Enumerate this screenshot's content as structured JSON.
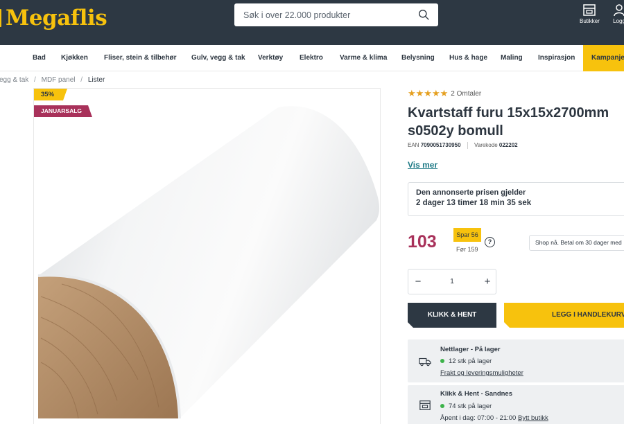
{
  "header": {
    "logo": "Megaflis",
    "search_placeholder": "Søk i over 22.000 produkter",
    "stores_label": "Butikker",
    "login_label": "Logg"
  },
  "nav": {
    "items": [
      "Bad",
      "Kjøkken",
      "Fliser, stein & tilbehør",
      "Gulv, vegg & tak",
      "Verktøy",
      "Elektro",
      "Varme & klima",
      "Belysning",
      "Hus & hage",
      "Maling",
      "Inspirasjon",
      "Kampanje"
    ]
  },
  "breadcrumb": {
    "items": [
      "vegg & tak",
      "MDF panel",
      "Lister"
    ],
    "separator": "/"
  },
  "badges": {
    "discount": "35%",
    "campaign": "JANUARSALG"
  },
  "product": {
    "stars": "★★★★★",
    "reviews": "2 Omtaler",
    "title": "Kvartstaff furu 15x15x2700mm s0502y bomull",
    "ean_label": "EAN",
    "ean": "7090051730950",
    "sku_label": "Varekode",
    "sku": "022202",
    "more_link": "Vis mer",
    "notice_line1": "Den annonserte prisen gjelder",
    "notice_line2": "2 dager 13 timer 18 min 35 sek",
    "price": "103",
    "save": "Spar 56",
    "before": "Før 159",
    "help": "?",
    "shop_now": "Shop nå. Betal om 30 dager med",
    "quantity": "1",
    "minus": "−",
    "plus": "+",
    "btn_click_collect": "KLIKK & HENT",
    "btn_add_cart": "LEGG I HANDLEKURV"
  },
  "stock": {
    "online_title": "Nettlager - På lager",
    "online_qty": "12 stk på lager",
    "online_link": "Frakt og leveringsmuligheter",
    "store_title": "Klikk & Hent - Sandnes",
    "store_qty": "74 stk på lager",
    "store_hours": "Åpent i dag: 07:00 - 21:00",
    "store_link": "Bytt butikk"
  },
  "colors": {
    "header_bg": "#2d3843",
    "accent_yellow": "#f7c20d",
    "price_red": "#a8315a",
    "link_teal": "#1f7a86",
    "in_stock_green": "#3db34a"
  }
}
